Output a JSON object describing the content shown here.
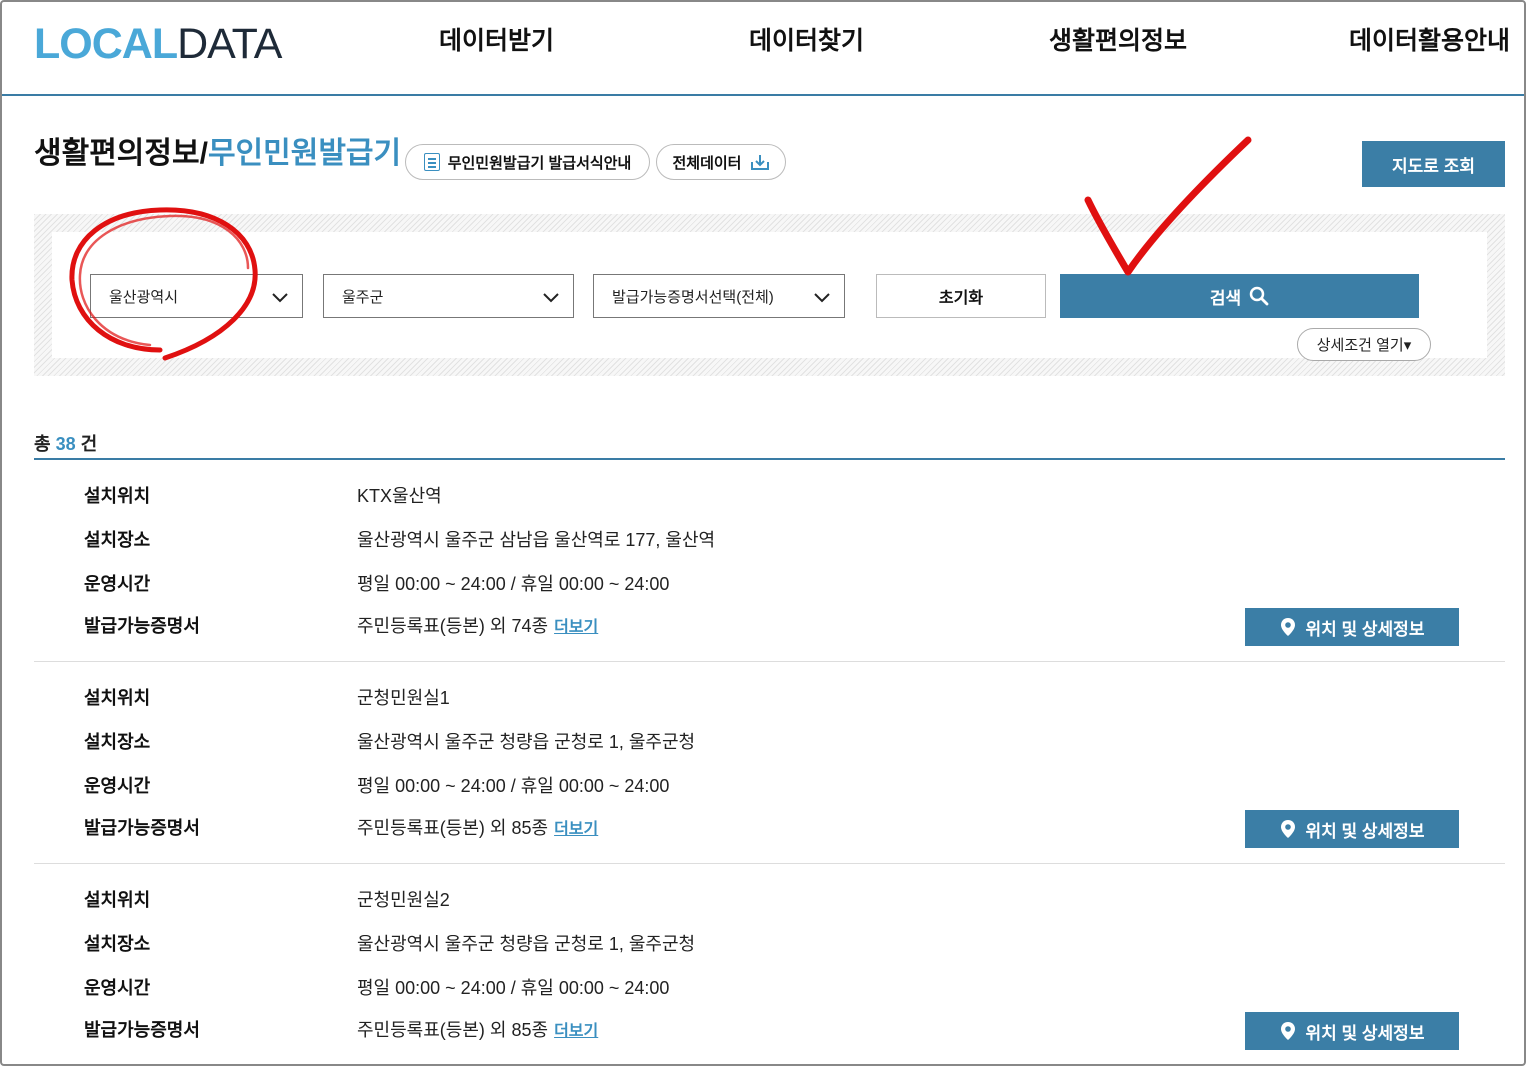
{
  "logo": {
    "part1": "LOCAL",
    "part2": "DATA"
  },
  "nav": {
    "item1": "데이터받기",
    "item2": "데이터찾기",
    "item3": "생활편의정보",
    "item4": "데이터활용안내"
  },
  "title": {
    "main": "생활편의정보/",
    "sub": "무인민원발급기"
  },
  "buttons": {
    "format_guide": "무인민원발급기 발급서식안내",
    "all_data": "전체데이터",
    "map_view": "지도로 조회"
  },
  "filters": {
    "region": "울산광역시",
    "district": "울주군",
    "certificate": "발급가능증명서선택(전체)",
    "reset": "초기화",
    "search": "검색",
    "detail": "상세조건 열기▾"
  },
  "total": {
    "prefix": "총",
    "count": "38",
    "suffix": "건"
  },
  "labels": {
    "location": "설치위치",
    "place": "설치장소",
    "hours": "운영시간",
    "certs": "발급가능증명서",
    "more": "더보기",
    "detail_button": "위치 및 상세정보"
  },
  "results": [
    {
      "location": "KTX울산역",
      "place": "울산광역시 울주군 삼남읍 울산역로 177, 울산역",
      "hours": "평일 00:00 ~ 24:00 / 휴일 00:00 ~ 24:00",
      "certs": "주민등록표(등본) 외 74종"
    },
    {
      "location": "군청민원실1",
      "place": "울산광역시 울주군 청량읍 군청로 1, 울주군청",
      "hours": "평일 00:00 ~ 24:00 / 휴일 00:00 ~ 24:00",
      "certs": "주민등록표(등본) 외 85종"
    },
    {
      "location": "군청민원실2",
      "place": "울산광역시 울주군 청량읍 군청로 1, 울주군청",
      "hours": "평일 00:00 ~ 24:00 / 휴일 00:00 ~ 24:00",
      "certs": "주민등록표(등본) 외 85종"
    }
  ],
  "colors": {
    "accent": "#3b7ea6",
    "link": "#3a8fc0",
    "annotation": "#e01010"
  }
}
